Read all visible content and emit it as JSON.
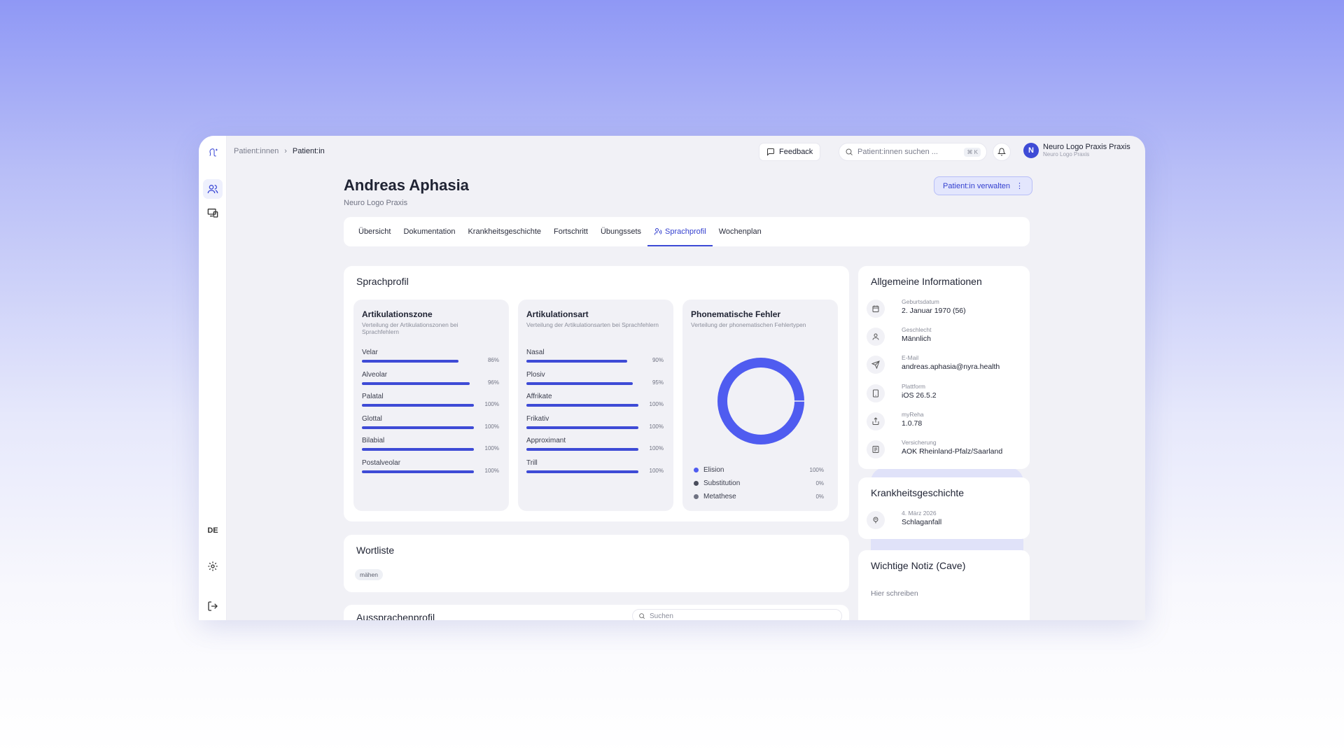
{
  "breadcrumb": {
    "parent": "Patient:innen",
    "current": "Patient:in"
  },
  "topbar": {
    "feedback_label": "Feedback",
    "search_placeholder": "Patient:innen suchen ...",
    "search_shortcut": "⌘ K",
    "user_initial": "N",
    "user_name": "Neuro Logo Praxis Praxis",
    "user_org": "Neuro Logo Praxis"
  },
  "sidebar": {
    "language": "DE"
  },
  "patient": {
    "name": "Andreas Aphasia",
    "practice": "Neuro Logo Praxis",
    "manage_label": "Patient:in verwalten"
  },
  "tabs": [
    {
      "label": "Übersicht"
    },
    {
      "label": "Dokumentation"
    },
    {
      "label": "Krankheitsgeschichte"
    },
    {
      "label": "Fortschritt"
    },
    {
      "label": "Übungssets"
    },
    {
      "label": "Sprachprofil",
      "active": true
    },
    {
      "label": "Wochenplan"
    }
  ],
  "sprachprofil": {
    "title": "Sprachprofil",
    "zone": {
      "title": "Artikulationszone",
      "desc": "Verteilung der Artikulationszonen bei Sprachfehlern",
      "items": [
        {
          "label": "Velar",
          "value": 86,
          "pct": "86%"
        },
        {
          "label": "Alveolar",
          "value": 96,
          "pct": "96%"
        },
        {
          "label": "Palatal",
          "value": 100,
          "pct": "100%"
        },
        {
          "label": "Glottal",
          "value": 100,
          "pct": "100%"
        },
        {
          "label": "Bilabial",
          "value": 100,
          "pct": "100%"
        },
        {
          "label": "Postalveolar",
          "value": 100,
          "pct": "100%"
        }
      ]
    },
    "art": {
      "title": "Artikulationsart",
      "desc": "Verteilung der Artikulationsarten bei Sprachfehlern",
      "items": [
        {
          "label": "Nasal",
          "value": 90,
          "pct": "90%"
        },
        {
          "label": "Plosiv",
          "value": 95,
          "pct": "95%"
        },
        {
          "label": "Affrikate",
          "value": 100,
          "pct": "100%"
        },
        {
          "label": "Frikativ",
          "value": 100,
          "pct": "100%"
        },
        {
          "label": "Approximant",
          "value": 100,
          "pct": "100%"
        },
        {
          "label": "Trill",
          "value": 100,
          "pct": "100%"
        }
      ]
    },
    "phon": {
      "title": "Phonematische Fehler",
      "desc": "Verteilung der phonematischen Fehlertypen",
      "items": [
        {
          "label": "Elision",
          "value": 100,
          "pct": "100%",
          "color": "#4f5cf0"
        },
        {
          "label": "Substitution",
          "value": 0,
          "pct": "0%",
          "color": "#4a4d5c"
        },
        {
          "label": "Metathese",
          "value": 0,
          "pct": "0%",
          "color": "#6f7282"
        }
      ]
    }
  },
  "wortliste": {
    "title": "Wortliste",
    "chip": "mähen"
  },
  "aussprache": {
    "title": "Aussprachenprofil",
    "search_placeholder": "Suchen"
  },
  "info": {
    "title": "Allgemeine Informationen",
    "rows": [
      {
        "icon": "calendar-icon",
        "label": "Geburtsdatum",
        "value": "2. Januar 1970 (56)"
      },
      {
        "icon": "person-icon",
        "label": "Geschlecht",
        "value": "Männlich"
      },
      {
        "icon": "send-icon",
        "label": "E-Mail",
        "value": "andreas.aphasia@nyra.health"
      },
      {
        "icon": "tablet-icon",
        "label": "Plattform",
        "value": "iOS 26.5.2"
      },
      {
        "icon": "share-icon",
        "label": "myReha",
        "value": "1.0.78"
      },
      {
        "icon": "insurance-icon",
        "label": "Versicherung",
        "value": "AOK Rheinland-Pfalz/Saarland"
      }
    ]
  },
  "history": {
    "title": "Krankheitsgeschichte",
    "date": "4. März 2026",
    "entry": "Schlaganfall"
  },
  "note": {
    "title": "Wichtige Notiz (Cave)",
    "placeholder": "Hier schreiben"
  },
  "colors": {
    "accent": "#3e4bd6",
    "accent_light": "#e3e6fd"
  }
}
